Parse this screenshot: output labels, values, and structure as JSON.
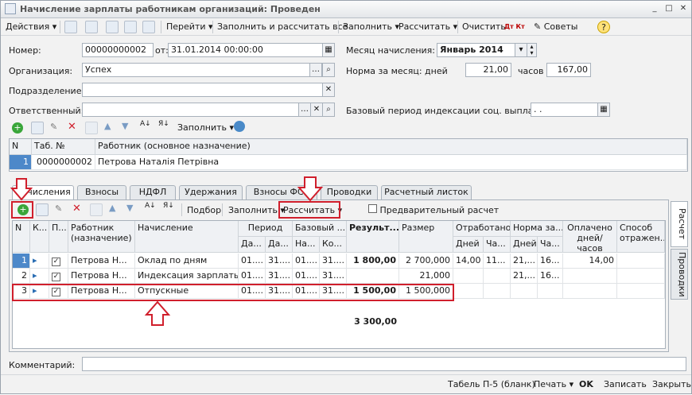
{
  "window": {
    "title": "Начисление зарплаты работникам организаций: Проведен"
  },
  "toolbar": {
    "actions": "Действия",
    "goto": "Перейти",
    "fill_calc": "Заполнить и рассчитать все",
    "fill": "Заполнить",
    "calc": "Рассчитать",
    "clear": "Очистить",
    "dtkt": "Дт Кт",
    "tips": "Советы"
  },
  "header": {
    "number_label": "Номер:",
    "number": "00000000002",
    "from_label": "от:",
    "date": "31.01.2014 00:00:00",
    "month_label": "Месяц начисления:",
    "month": "Январь 2014",
    "org_label": "Организация:",
    "org": "Успех",
    "norm_label": "Норма за месяц: дней",
    "norm_days": "21,00",
    "hours_label": "часов",
    "norm_hours": "167,00",
    "dept_label": "Подразделение:",
    "dept": "",
    "resp_label": "Ответственный:",
    "resp": "",
    "index_label": "Базовый период индексации соц. выплат:",
    "index_value": ". ."
  },
  "emp_toolbar": {
    "fill": "Заполнить"
  },
  "emp_table": {
    "headers": [
      "N",
      "Таб. №",
      "Работник (основное назначение)"
    ],
    "rows": [
      {
        "n": "1",
        "tab": "0000000002",
        "name": "Петрова Наталія Петрівна"
      }
    ]
  },
  "tabs": [
    "Начисления",
    "Взносы",
    "НДФЛ",
    "Удержания",
    "Взносы ФСС",
    "Проводки",
    "Расчетный листок"
  ],
  "acc_toolbar": {
    "pick": "Подбор",
    "fill": "Заполнить",
    "calc": "Рассчитать",
    "prelim": "Предварительный расчет"
  },
  "acc_table": {
    "h1": [
      "N",
      "К...",
      "П...",
      "Работник (назначение)",
      "Начисление",
      "Период",
      "Базовый ...",
      "Результ...",
      "Размер",
      "Отработано",
      "Норма за...",
      "Оплачено дней/часов",
      "Способ отражен..."
    ],
    "h2": [
      "Да...",
      "Да...",
      "На...",
      "Ко...",
      "Дней",
      "Ча...",
      "Дней",
      "Ча..."
    ],
    "rows": [
      {
        "n": "1",
        "emp": "Петрова Н...",
        "acc": "Оклад по дням",
        "p1": "01....",
        "p2": "31....",
        "b1": "01....",
        "b2": "31....",
        "res": "1 800,00",
        "size": "2 700,000",
        "wd": "14,00",
        "wh": "11...",
        "nd": "21,...",
        "nh": "16...",
        "paid": "14,00"
      },
      {
        "n": "2",
        "emp": "Петрова Н...",
        "acc": "Индексация зарплаты",
        "p1": "01....",
        "p2": "31....",
        "b1": "01....",
        "b2": "31....",
        "res": "",
        "size": "21,000",
        "wd": "",
        "wh": "",
        "nd": "21,...",
        "nh": "16...",
        "paid": ""
      },
      {
        "n": "3",
        "emp": "Петрова Н...",
        "acc": "Отпускные",
        "p1": "01....",
        "p2": "31....",
        "b1": "01....",
        "b2": "31....",
        "res": "1 500,00",
        "size": "1 500,000",
        "wd": "",
        "wh": "",
        "nd": "",
        "nh": "",
        "paid": ""
      }
    ],
    "total": "3 300,00"
  },
  "side_tabs": [
    "Расчет",
    "Проводки"
  ],
  "comment_label": "Комментарий:",
  "status": {
    "form": "Табель П-5 (бланк)",
    "print": "Печать",
    "ok": "OK",
    "save": "Записать",
    "close": "Закрыть"
  }
}
